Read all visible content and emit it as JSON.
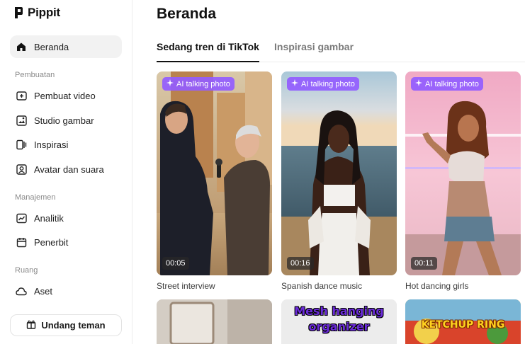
{
  "app": {
    "name": "Pippit"
  },
  "sidebar": {
    "home": "Beranda",
    "sections": {
      "create": "Pembuatan",
      "manage": "Manajemen",
      "space": "Ruang"
    },
    "create_items": [
      "Pembuat video",
      "Studio gambar",
      "Inspirasi",
      "Avatar dan suara"
    ],
    "manage_items": [
      "Analitik",
      "Penerbit"
    ],
    "space_items": [
      "Aset"
    ],
    "invite": "Undang teman"
  },
  "main": {
    "title": "Beranda",
    "tabs": [
      "Sedang tren di TikTok",
      "Inspirasi gambar"
    ],
    "cards": [
      {
        "badge": "AI talking photo",
        "duration": "00:05",
        "caption": "Street interview"
      },
      {
        "badge": "AI talking photo",
        "duration": "00:16",
        "caption": "Spanish dance music"
      },
      {
        "badge": "AI talking photo",
        "duration": "00:11",
        "caption": "Hot dancing girls"
      }
    ],
    "row2": [
      {
        "overlay": ""
      },
      {
        "overlay": "Mesh hanging organizer"
      },
      {
        "overlay": "KETCHUP RING"
      }
    ]
  },
  "colors": {
    "badge": "#925cff",
    "accent": "#111111"
  },
  "icons": [
    "pippit-logo-icon",
    "home-icon",
    "video-plus-icon",
    "image-edit-icon",
    "inspiration-icon",
    "avatar-icon",
    "analytics-icon",
    "calendar-icon",
    "cloud-icon",
    "gift-icon",
    "sparkle-icon"
  ]
}
